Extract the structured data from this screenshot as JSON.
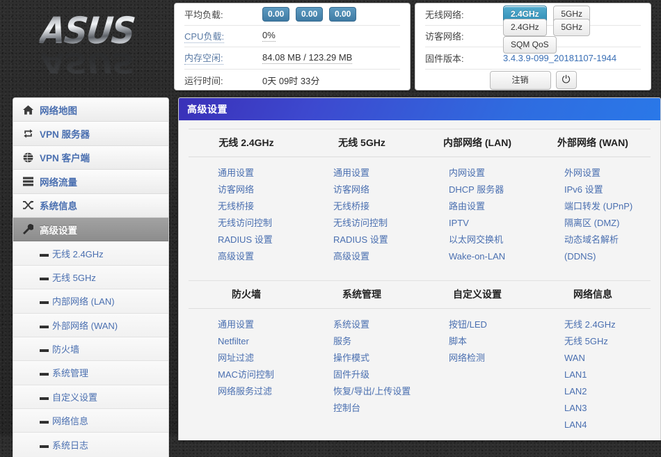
{
  "brand": {
    "logo_text": "ASUS"
  },
  "status_panel": {
    "rows": [
      {
        "label": "平均负载:",
        "type": "badges",
        "badges": [
          "0.00",
          "0.00",
          "0.00"
        ]
      },
      {
        "label": "CPU负载:",
        "type": "text",
        "value": "0%"
      },
      {
        "label": "内存空闲:",
        "type": "text",
        "value": "84.08 MB / 123.29 MB"
      },
      {
        "label": "运行时间:",
        "type": "text",
        "value": "0天 09时 33分"
      }
    ]
  },
  "sysinfo_panel": {
    "wireless_label": "无线网络:",
    "wireless_buttons": [
      {
        "label": "2.4GHz",
        "active": true
      },
      {
        "label": "5GHz",
        "active": false
      }
    ],
    "guest_label": "访客网络:",
    "guest_buttons": [
      {
        "label": "2.4GHz",
        "active": false
      },
      {
        "label": "5GHz",
        "active": false
      },
      {
        "label": "SQM QoS",
        "active": false
      }
    ],
    "firmware_label": "固件版本:",
    "firmware_value": "3.4.3.9-099_20181107-1944",
    "logout_label": "注销",
    "power_icon": "⏻"
  },
  "sidebar": {
    "items": [
      {
        "label": "网络地图",
        "icon": "home-icon",
        "glyph": "⌂",
        "active": false
      },
      {
        "label": "VPN 服务器",
        "icon": "loop-arrows-icon",
        "glyph": "⇄",
        "active": false
      },
      {
        "label": "VPN 客户端",
        "icon": "globe-icon",
        "glyph": "🌐",
        "active": false
      },
      {
        "label": "网络流量",
        "icon": "server-bars-icon",
        "glyph": "▤",
        "active": false
      },
      {
        "label": "系统信息",
        "icon": "shuffle-icon",
        "glyph": "⤫",
        "active": false
      },
      {
        "label": "高级设置",
        "icon": "wrench-icon",
        "glyph": "🔧",
        "active": true
      }
    ],
    "sub_items": [
      {
        "label": "无线 2.4GHz",
        "marker": "▬"
      },
      {
        "label": "无线 5GHz",
        "marker": "▬"
      },
      {
        "label": "内部网络 (LAN)",
        "marker": "▬"
      },
      {
        "label": "外部网络 (WAN)",
        "marker": "▬"
      },
      {
        "label": "防火墙",
        "marker": "▬"
      },
      {
        "label": "系统管理",
        "marker": "▬"
      },
      {
        "label": "自定义设置",
        "marker": "▬"
      },
      {
        "label": "网络信息",
        "marker": "▬"
      },
      {
        "label": "系统日志",
        "marker": "▬"
      }
    ]
  },
  "main": {
    "header_title": "高级设置",
    "row1": [
      {
        "heading": "无线 2.4GHz",
        "links": [
          "通用设置",
          "访客网络",
          "无线桥接",
          "无线访问控制",
          "RADIUS 设置",
          "高级设置"
        ]
      },
      {
        "heading": "无线 5GHz",
        "links": [
          "通用设置",
          "访客网络",
          "无线桥接",
          "无线访问控制",
          "RADIUS 设置",
          "高级设置"
        ]
      },
      {
        "heading": "内部网络 (LAN)",
        "links": [
          "内网设置",
          "DHCP 服务器",
          "路由设置",
          "IPTV",
          "以太网交换机",
          "Wake-on-LAN"
        ]
      },
      {
        "heading": "外部网络 (WAN)",
        "links": [
          "外网设置",
          "IPv6 设置",
          "端口转发 (UPnP)",
          "隔离区 (DMZ)",
          "动态域名解析 (DDNS)"
        ]
      }
    ],
    "row2": [
      {
        "heading": "防火墙",
        "links": [
          "通用设置",
          "Netfilter",
          "网址过滤",
          "MAC访问控制",
          "网络服务过滤"
        ]
      },
      {
        "heading": "系统管理",
        "links": [
          "系统设置",
          "服务",
          "操作模式",
          "固件升级",
          "恢复/导出/上传设置",
          "控制台"
        ]
      },
      {
        "heading": "自定义设置",
        "links": [
          "按钮/LED",
          "脚本",
          "网络检测"
        ]
      },
      {
        "heading": "网络信息",
        "links": [
          "无线 2.4GHz",
          "无线 5GHz",
          "WAN",
          "LAN1",
          "LAN2",
          "LAN3",
          "LAN4"
        ]
      }
    ]
  },
  "colors": {
    "accent_blue": "#4a6fb0",
    "badge_blue": "#3f7ba4",
    "header_gradient_start": "#3a30b8",
    "header_gradient_end": "#2a78e8",
    "active_button_blue": "#2e8cb4"
  }
}
